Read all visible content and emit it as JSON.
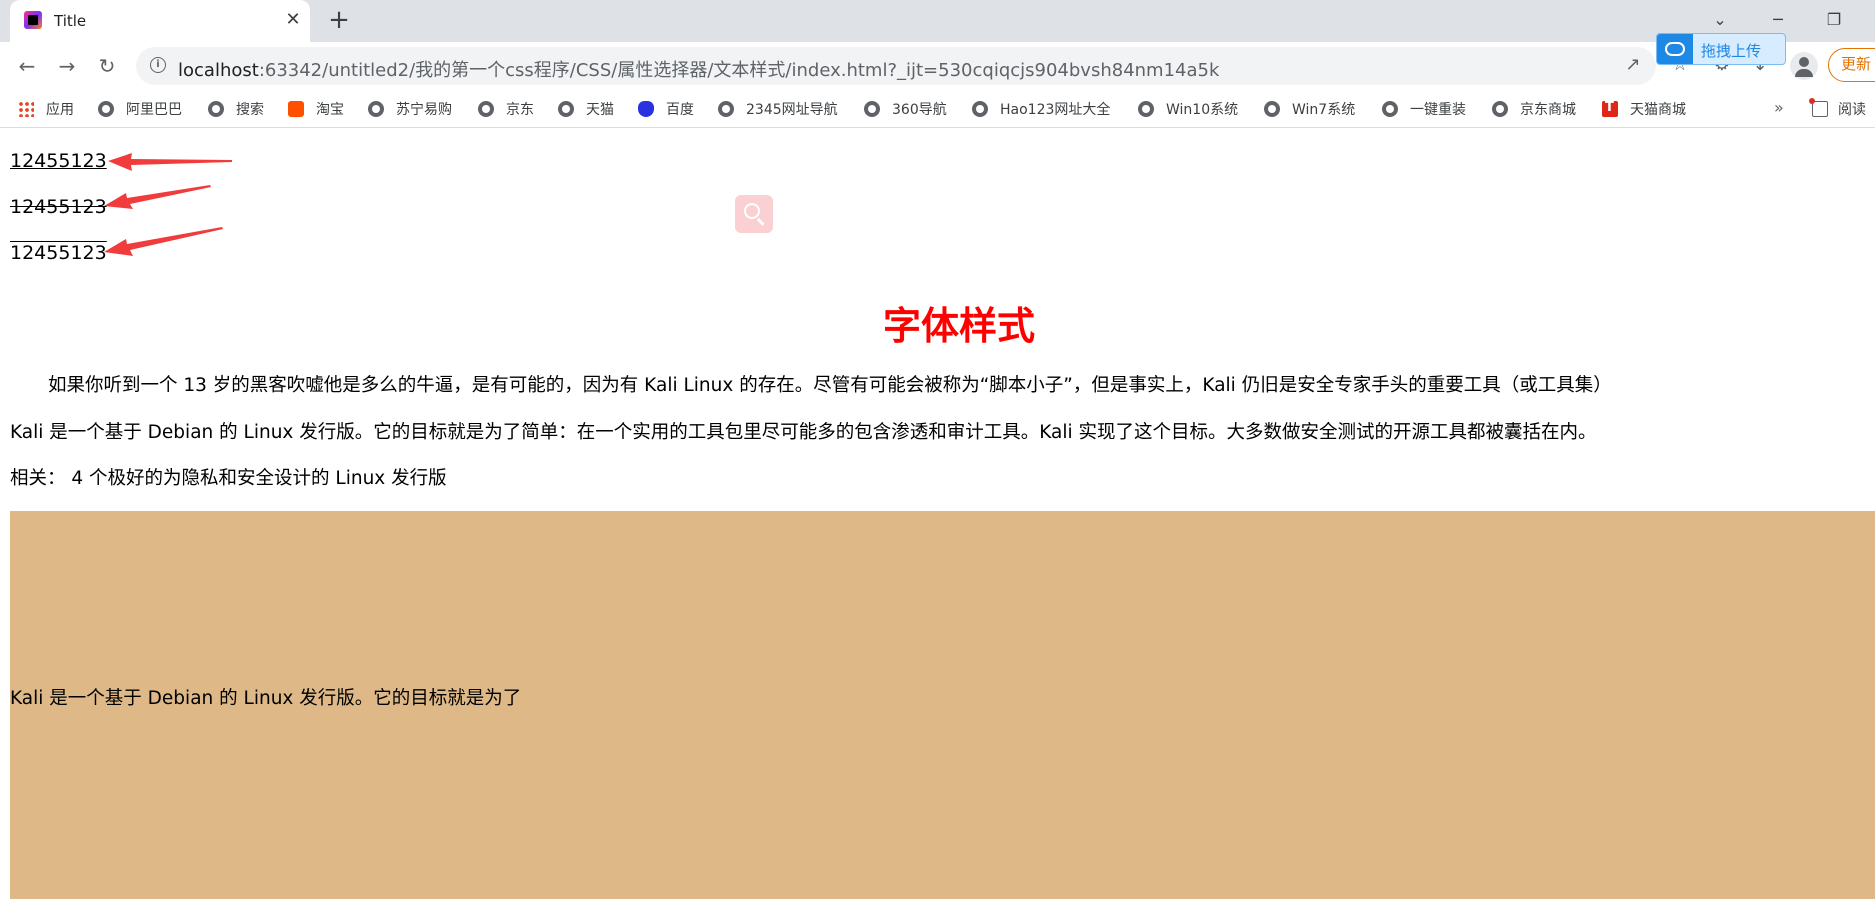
{
  "browser": {
    "tab": {
      "title": "Title",
      "close": "✕"
    },
    "new_tab": "+",
    "window": {
      "minimize": "─",
      "restore": "❐",
      "dropdown": "⌄"
    },
    "address": {
      "host": "localhost",
      "rest": ":63342/untitled2/我的第一个css程序/CSS/属性选择器/文本样式/index.html?_ijt=530cqiqcjs904bvsh84nm14a5k"
    },
    "upload_label": "拖拽上传",
    "update_label": "更新",
    "bookmarks": [
      {
        "label": "应用",
        "icon": "apps-grid-icon"
      },
      {
        "label": "阿里巴巴",
        "icon": "globe-icon"
      },
      {
        "label": "搜索",
        "icon": "globe-icon"
      },
      {
        "label": "淘宝",
        "icon": "taobao-icon"
      },
      {
        "label": "苏宁易购",
        "icon": "globe-icon"
      },
      {
        "label": "京东",
        "icon": "globe-icon"
      },
      {
        "label": "天猫",
        "icon": "globe-icon"
      },
      {
        "label": "百度",
        "icon": "baidu-icon"
      },
      {
        "label": "2345网址导航",
        "icon": "globe-icon"
      },
      {
        "label": "360导航",
        "icon": "globe-icon"
      },
      {
        "label": "Hao123网址大全",
        "icon": "globe-icon"
      },
      {
        "label": "Win10系统",
        "icon": "globe-icon"
      },
      {
        "label": "Win7系统",
        "icon": "globe-icon"
      },
      {
        "label": "一键重装",
        "icon": "globe-icon"
      },
      {
        "label": "京东商城",
        "icon": "globe-icon"
      },
      {
        "label": "天猫商城",
        "icon": "tmall-icon"
      }
    ],
    "bookmarks_more": "»",
    "reading_list": "阅读"
  },
  "page": {
    "underline_text": "12455123",
    "strike_text": "12455123",
    "overline_text": "12455123",
    "heading": "字体样式",
    "paragraph1": "如果你听到一个 13 岁的黑客吹嘘他是多么的牛逼，是有可能的，因为有 Kali Linux 的存在。尽管有可能会被称为“脚本小子”，但是事实上，Kali 仍旧是安全专家手头的重要工具（或工具集）",
    "paragraph2": "Kali 是一个基于 Debian 的 Linux 发行版。它的目标就是为了简单：在一个实用的工具包里尽可能多的包含渗透和审计工具。Kali 实现了这个目标。大多数做安全测试的开源工具都被囊括在内。",
    "paragraph3": "相关：  4 个极好的为隐私和安全设计的 Linux 发行版",
    "block_text": "Kali 是一个基于 Debian 的 Linux 发行版。它的目标就是为了",
    "block_color": "#deb887",
    "heading_color": "#ff0000",
    "arrow_color": "#f03c3c"
  }
}
